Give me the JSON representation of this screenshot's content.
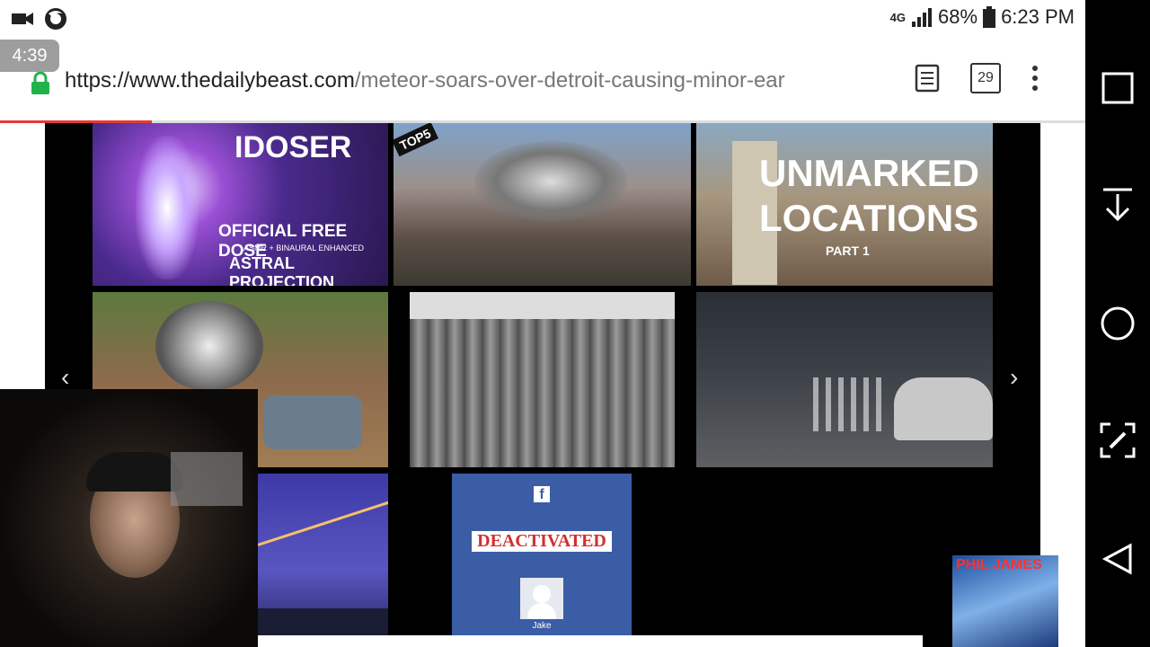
{
  "status_bar": {
    "network": "4G",
    "battery": "68%",
    "time": "6:23 PM"
  },
  "overlay": {
    "timer": "4:39"
  },
  "browser": {
    "url_host": "https://www.thedailybeast.com",
    "url_path": "/meteor-soars-over-detroit-causing-minor-ear",
    "tab_count": "29",
    "progress_percent": 14
  },
  "gallery": {
    "thumbs": [
      {
        "title_main": "IDOSER",
        "line1": "OFFICIAL FREE DOSE",
        "line2": "ASMR + BINAURAL ENHANCED",
        "line3": "ASTRAL PROJECTION"
      },
      {
        "corner_badge": "TOP5"
      },
      {
        "title_line1": "UNMARKED",
        "title_line2": "LOCATIONS",
        "subtitle": "PART 1"
      },
      {},
      {},
      {},
      {},
      {
        "banner": "DEACTIVATED",
        "name": "Jake"
      }
    ],
    "prev_arrow": "‹",
    "next_arrow": "›"
  },
  "cover_art": {
    "title": "PHIL JAMES"
  },
  "colors": {
    "progress": "#e53935",
    "facebook_blue": "#3b5da6",
    "deactivated_red": "#d32f2f"
  }
}
